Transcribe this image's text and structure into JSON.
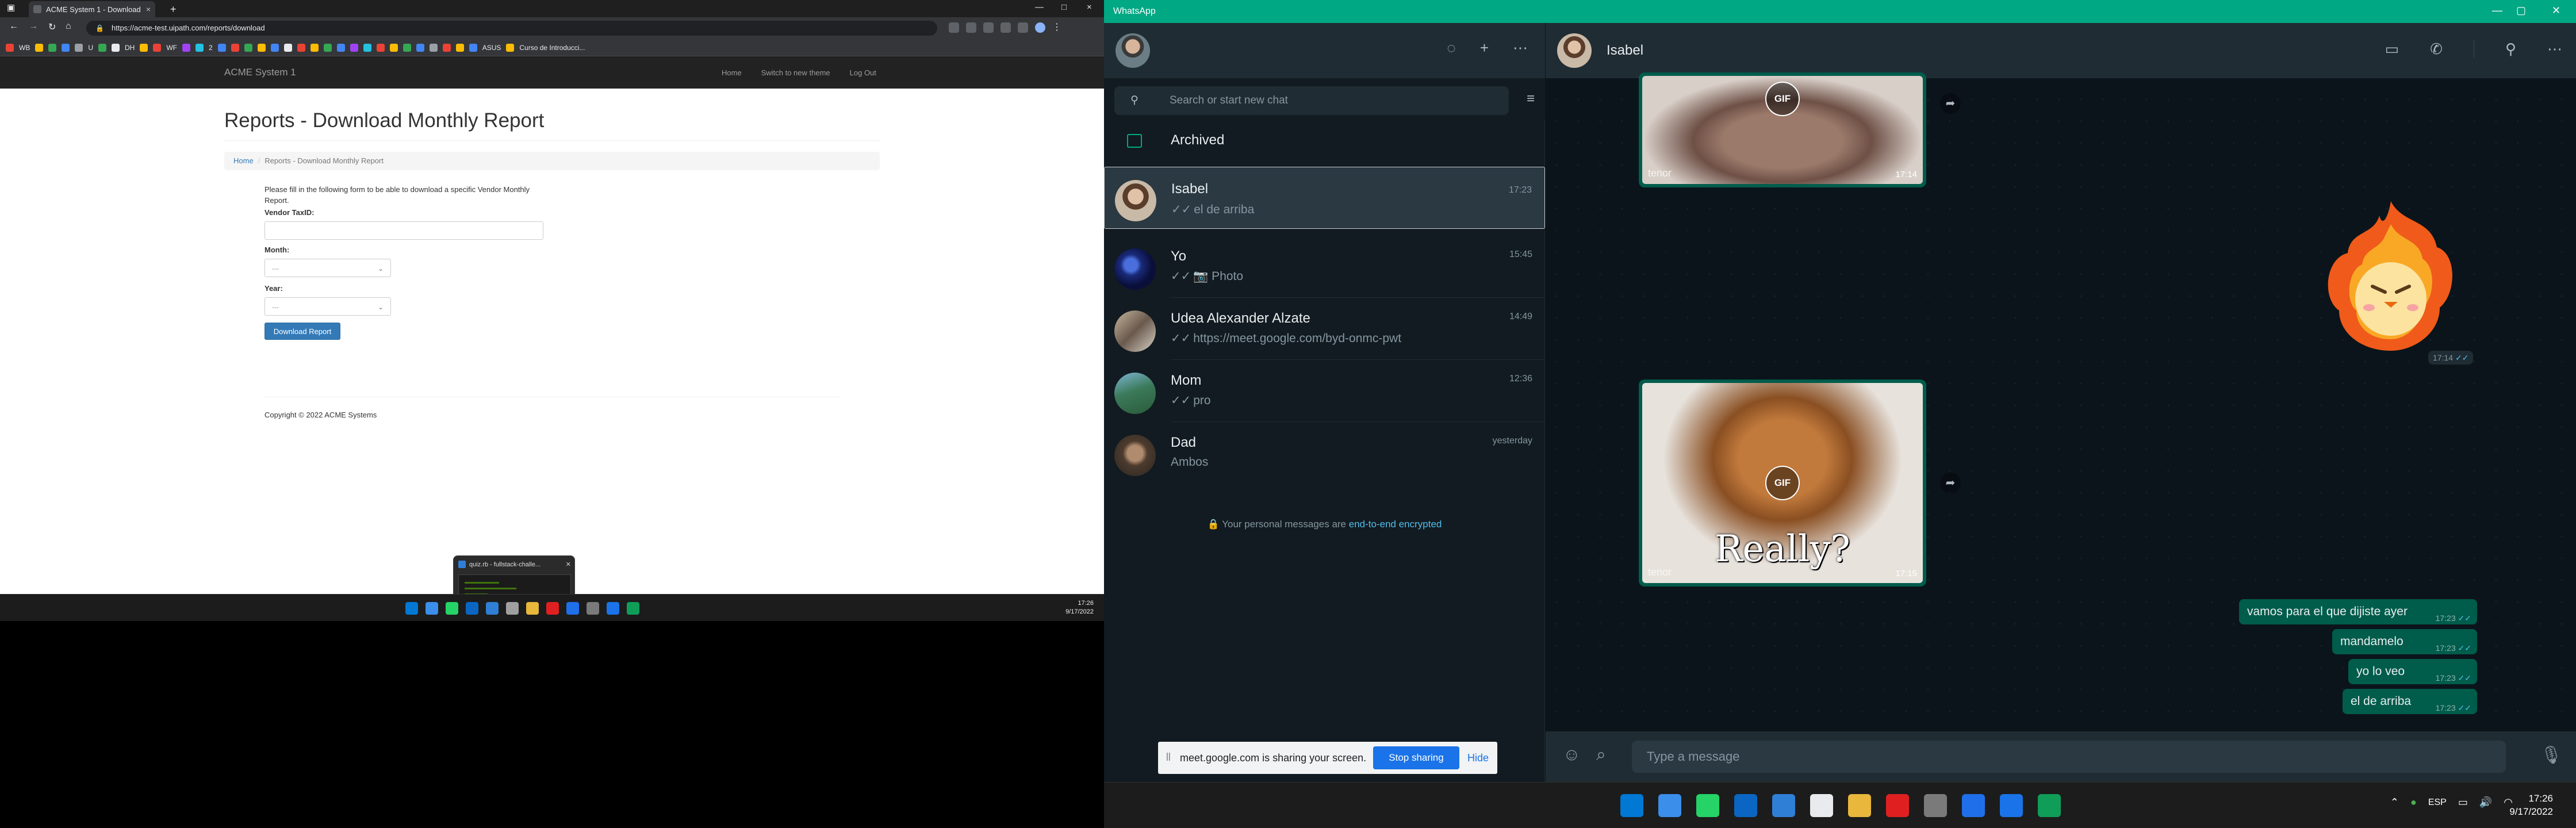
{
  "browser": {
    "tab_title": "ACME System 1 - Download Mo...",
    "tab_close": "×",
    "new_tab": "+",
    "url": "https://acme-test.uipath.com/reports/download",
    "window_controls": [
      "—",
      "□",
      "×"
    ],
    "bookmarks": [
      {
        "label": "WB",
        "color": "#ea4335"
      },
      {
        "label": "",
        "color": "#fbbc04"
      },
      {
        "label": "",
        "color": "#34a853"
      },
      {
        "label": "",
        "color": "#4285f4"
      },
      {
        "label": "U",
        "color": "#9aa0a6"
      },
      {
        "label": "",
        "color": "#34a853"
      },
      {
        "label": "DH",
        "color": "#e8eaed"
      },
      {
        "label": "",
        "color": "#fbbc04"
      },
      {
        "label": "WF",
        "color": "#ea4335"
      },
      {
        "label": "",
        "color": "#a142f4"
      },
      {
        "label": "2",
        "color": "#24c1e0"
      },
      {
        "label": "",
        "color": "#4285f4"
      },
      {
        "label": "",
        "color": "#ea4335"
      },
      {
        "label": "",
        "color": "#34a853"
      },
      {
        "label": "",
        "color": "#fbbc04"
      },
      {
        "label": "",
        "color": "#4285f4"
      },
      {
        "label": "",
        "color": "#e8eaed"
      },
      {
        "label": "",
        "color": "#ea4335"
      },
      {
        "label": "",
        "color": "#fbbc04"
      },
      {
        "label": "",
        "color": "#34a853"
      },
      {
        "label": "",
        "color": "#4285f4"
      },
      {
        "label": "",
        "color": "#a142f4"
      },
      {
        "label": "",
        "color": "#24c1e0"
      },
      {
        "label": "",
        "color": "#ea4335"
      },
      {
        "label": "",
        "color": "#fbbc04"
      },
      {
        "label": "",
        "color": "#34a853"
      },
      {
        "label": "",
        "color": "#4285f4"
      },
      {
        "label": "",
        "color": "#9aa0a6"
      },
      {
        "label": "",
        "color": "#ea4335"
      },
      {
        "label": "",
        "color": "#fbbc04"
      },
      {
        "label": "ASUS",
        "color": "#4285f4"
      },
      {
        "label": "Curso de Introducci...",
        "color": "#fbbc04"
      }
    ]
  },
  "site": {
    "brand": "ACME System 1",
    "nav": [
      "Home",
      "Switch to new theme",
      "Log Out"
    ],
    "title": "Reports - Download Monthly Report",
    "breadcrumb_home": "Home",
    "breadcrumb_sep": "/",
    "breadcrumb_current": "Reports - Download Monthly Report",
    "intro": "Please fill in the following form to be able to download a specific Vendor Monthly Report.",
    "vendor_label": "Vendor TaxID:",
    "vendor_value": "",
    "month_label": "Month:",
    "month_value": "---",
    "year_label": "Year:",
    "year_value": "---",
    "download_button": "Download Report",
    "copyright": "Copyright © 2022 ACME Systems"
  },
  "thumbnail": {
    "title": "quiz.rb - fullstack-challe..."
  },
  "left_taskbar": {
    "time": "17:26",
    "date": "9/17/2022",
    "icon_colors": [
      "#0078d4",
      "#3b8eea",
      "#25d366",
      "#0a66c2",
      "#2f7fd6",
      "#a0a0a0",
      "#e8b73b",
      "#e02020",
      "#1f6feb",
      "#7a7a7a",
      "#1a73e8",
      "#0f9d58"
    ]
  },
  "whatsapp": {
    "app_title": "WhatsApp",
    "window_controls": [
      "—",
      "▢",
      "✕"
    ],
    "search_placeholder": "Search or start new chat",
    "archived_label": "Archived",
    "chats": [
      {
        "name": "Isabel",
        "time": "17:23",
        "preview": "el de arriba",
        "selected": true
      },
      {
        "name": "Yo",
        "time": "15:45",
        "preview": "📷 Photo",
        "selected": false
      },
      {
        "name": "Udea Alexander Alzate",
        "time": "14:49",
        "preview": "https://meet.google.com/byd-onmc-pwt",
        "selected": false
      },
      {
        "name": "Mom",
        "time": "12:36",
        "preview": "pro",
        "selected": false
      },
      {
        "name": "Dad",
        "time": "yesterday",
        "preview": "Ambos",
        "selected": false
      }
    ],
    "encrypted_text": "Your personal messages are ",
    "encrypted_link": "end-to-end encrypted",
    "share_bar": {
      "message": "meet.google.com is sharing your screen.",
      "stop_label": "Stop sharing",
      "hide_label": "Hide"
    },
    "conversation": {
      "contact_name": "Isabel",
      "gif_badge": "GIF",
      "tenor_label": "tenor",
      "gif1_time": "17:14",
      "sticker_time": "17:14",
      "gif2_time": "17:15",
      "gif2_caption": "Really?",
      "messages": [
        {
          "text": "vamos para el que dijiste ayer",
          "time": "17:23"
        },
        {
          "text": "mandamelo",
          "time": "17:23"
        },
        {
          "text": "yo lo veo",
          "time": "17:23"
        },
        {
          "text": "el de arriba",
          "time": "17:23"
        }
      ],
      "compose_placeholder": "Type a message"
    }
  },
  "right_taskbar": {
    "language": "ESP",
    "time": "17:26",
    "date": "9/17/2022",
    "icon_colors": [
      "#0078d4",
      "#3b8eea",
      "#25d366",
      "#0a66c2",
      "#2f7fd6",
      "#e8eaed",
      "#e8b73b",
      "#e02020",
      "#7a7a7a",
      "#1f6feb",
      "#1a73e8",
      "#0f9d58"
    ]
  }
}
